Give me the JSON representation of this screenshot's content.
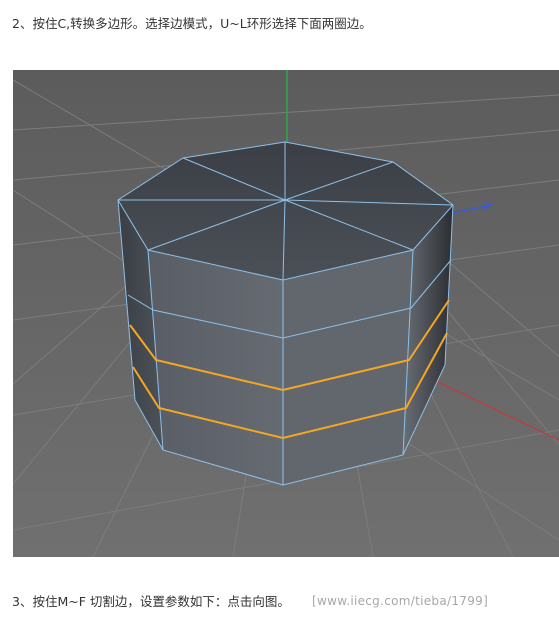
{
  "tutorial": {
    "step2_text": "2、按住C,转换多边形。选择边模式，U~L环形选择下面两圈边。",
    "step3_text": "3、按住M~F 切割边，设置参数如下：点击向图。",
    "watermark_text": "[www.iiecg.com/tieba/1799]"
  },
  "viewport": {
    "background_color": "#6a6a6a",
    "grid_color": "#7c7c7c",
    "mesh_face_color": "#4a4f56",
    "mesh_edge_color": "#8fc0e8",
    "selected_edge_color": "#f5a623",
    "axis_y_color": "#2ea84a",
    "axis_x_color": "#c23a3a",
    "axis_z_color": "#3a5ad8"
  }
}
